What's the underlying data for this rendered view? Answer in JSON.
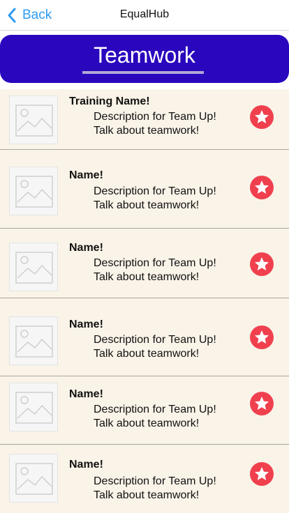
{
  "nav": {
    "back_label": "Back",
    "title": "EqualHub"
  },
  "hero": {
    "title": "Teamwork"
  },
  "items": [
    {
      "name": "Training Name!",
      "desc1": "Description for Team Up!",
      "desc2": "Talk about teamwork!"
    },
    {
      "name": "Name!",
      "desc1": "Description for Team Up!",
      "desc2": "Talk about teamwork!"
    },
    {
      "name": "Name!",
      "desc1": "Description for Team Up!",
      "desc2": "Talk about teamwork!"
    },
    {
      "name": "Name!",
      "desc1": "Description for Team Up!",
      "desc2": "Talk about teamwork!"
    },
    {
      "name": "Name!",
      "desc1": "Description for Team Up!",
      "desc2": "Talk about teamwork!"
    },
    {
      "name": "Name!",
      "desc1": "Description for Team Up!",
      "desc2": "Talk about teamwork!"
    }
  ],
  "colors": {
    "accent": "#2d9bf0",
    "hero": "#2a06bd",
    "list_bg": "#faf3e8",
    "star": "#f0404e"
  },
  "icons": {
    "back": "chevron-left-icon",
    "thumb": "image-placeholder-icon",
    "favorite": "star-icon"
  }
}
